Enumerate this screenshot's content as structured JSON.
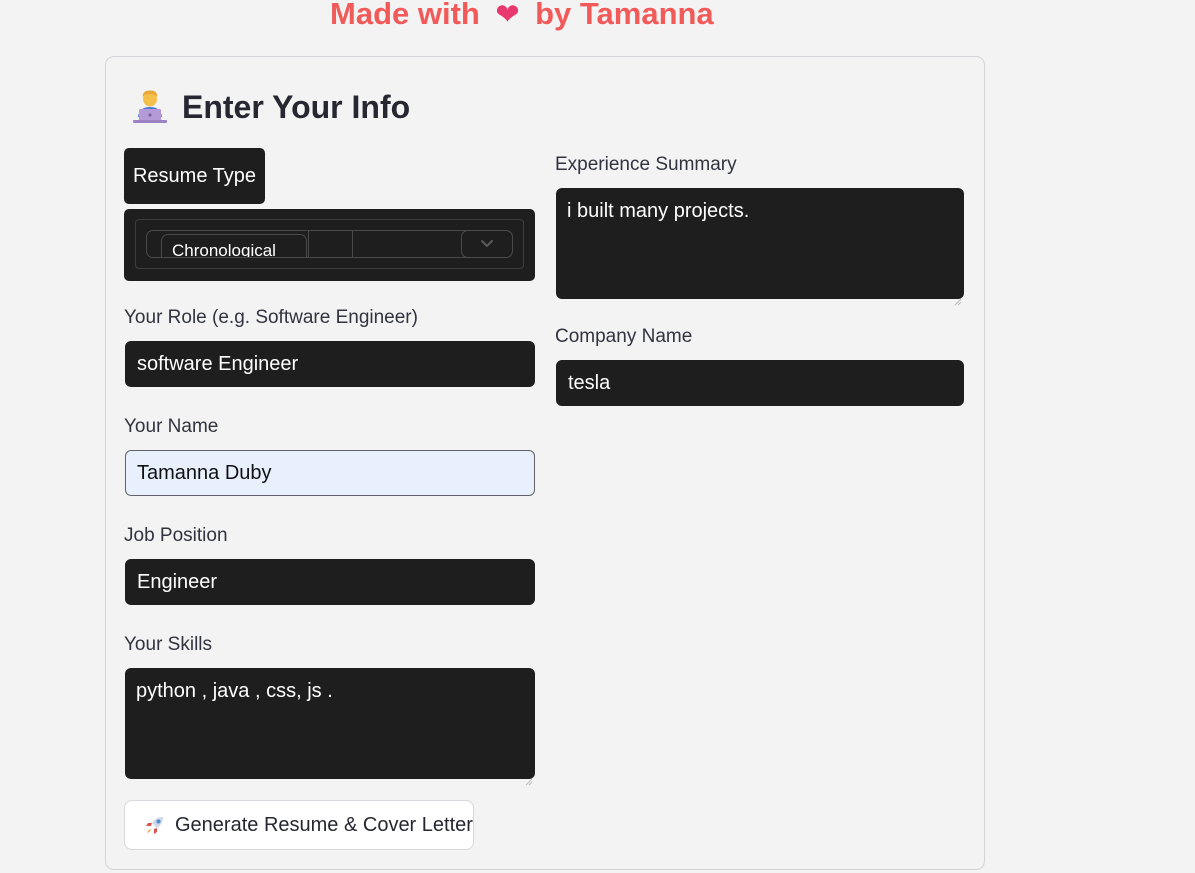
{
  "banner": {
    "prefix": "Made with",
    "heart": "❤",
    "suffix": "by Tamanna"
  },
  "form": {
    "heading": "Enter Your Info",
    "heading_icon": "technologist-emoji",
    "resume_type": {
      "label": "Resume Type",
      "selected": "Chronological"
    },
    "role": {
      "label": "Your Role (e.g. Software Engineer)",
      "value": "software Engineer"
    },
    "name": {
      "label": "Your Name",
      "value": "Tamanna Duby"
    },
    "job_position": {
      "label": "Job Position",
      "value": "Engineer"
    },
    "skills": {
      "label": "Your Skills",
      "value": "python , java , css, js ."
    },
    "experience": {
      "label": "Experience Summary",
      "value": "i built many projects."
    },
    "company": {
      "label": "Company Name",
      "value": "tesla"
    },
    "submit": {
      "icon": "rocket-emoji",
      "label": "Generate Resume & Cover Letter"
    }
  },
  "colors": {
    "banner": "#f25a5a",
    "input_bg": "#1e1e1e",
    "autofill_bg": "#e8f0fe",
    "page_bg": "#f3f3f3"
  }
}
